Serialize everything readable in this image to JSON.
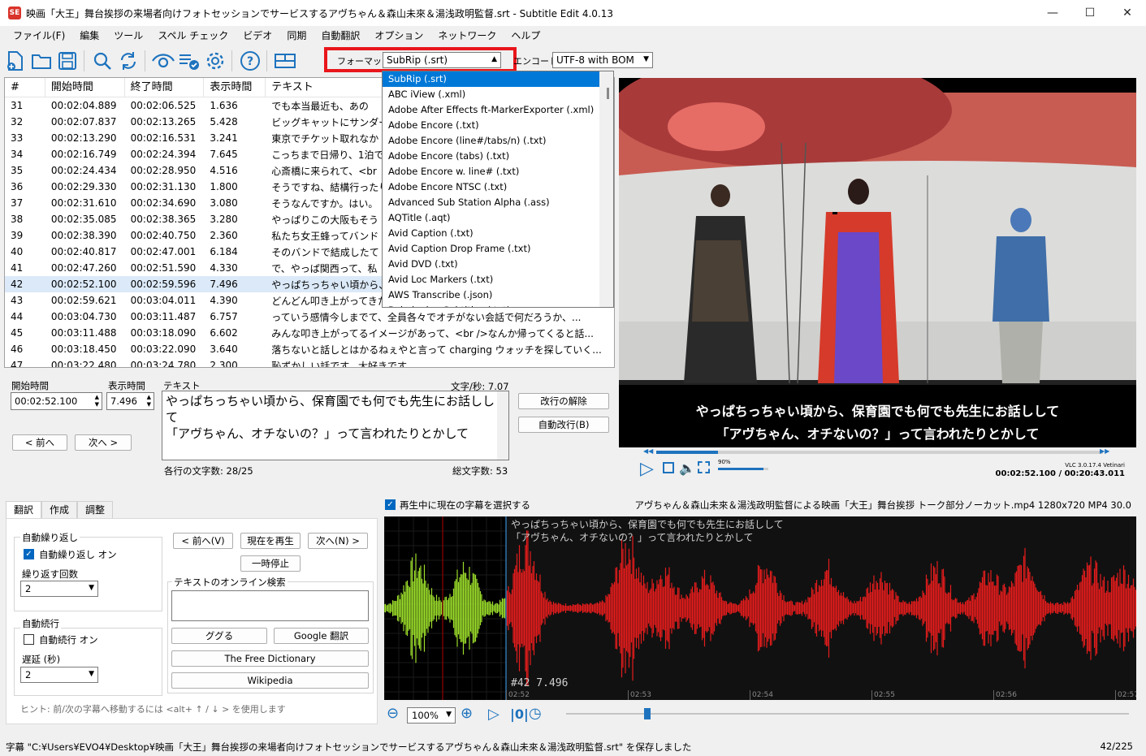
{
  "window": {
    "title": "映画「大王」舞台挨拶の来場者向けフォトセッションでサービスするアヴちゃん＆森山未來＆湯浅政明監督.srt - Subtitle Edit 4.0.13",
    "app_icon_text": "SE"
  },
  "menu": [
    "ファイル(F)",
    "編集",
    "ツール",
    "スペル チェック",
    "ビデオ",
    "同期",
    "自動翻訳",
    "オプション",
    "ネットワーク",
    "ヘルプ"
  ],
  "toolbar": {
    "format_label": "フォーマット",
    "format_value": "SubRip (.srt)",
    "encoding_label": "エンコード",
    "encoding_value": "UTF-8 with BOM"
  },
  "table": {
    "headers": [
      "#",
      "開始時間",
      "終了時間",
      "表示時間",
      "テキスト"
    ],
    "rows": [
      [
        "31",
        "00:02:04.889",
        "00:02:06.525",
        "1.636",
        "でも本当最近も、あの"
      ],
      [
        "32",
        "00:02:07.837",
        "00:02:13.265",
        "5.428",
        "ビッグキャットにサンダー"
      ],
      [
        "33",
        "00:02:13.290",
        "00:02:16.531",
        "3.241",
        "東京でチケット取れなか"
      ],
      [
        "34",
        "00:02:16.749",
        "00:02:24.394",
        "7.645",
        "こっちまで日帰り、1泊で"
      ],
      [
        "35",
        "00:02:24.434",
        "00:02:28.950",
        "4.516",
        "心斎橋に来られて、<br"
      ],
      [
        "36",
        "00:02:29.330",
        "00:02:31.130",
        "1.800",
        "そうですね、結構行ったり"
      ],
      [
        "37",
        "00:02:31.610",
        "00:02:34.690",
        "3.080",
        "そうなんですか。はい。"
      ],
      [
        "38",
        "00:02:35.085",
        "00:02:38.365",
        "3.280",
        "やっぱりこの大阪もそう"
      ],
      [
        "39",
        "00:02:38.390",
        "00:02:40.750",
        "2.360",
        "私たち女王蜂ってバンド"
      ],
      [
        "40",
        "00:02:40.817",
        "00:02:47.001",
        "6.184",
        "そのバンドで結成したて"
      ],
      [
        "41",
        "00:02:47.260",
        "00:02:51.590",
        "4.330",
        "で、やっぱ関西って、私"
      ],
      [
        "42",
        "00:02:52.100",
        "00:02:59.596",
        "7.496",
        "やっぱちっちゃい頃から、"
      ],
      [
        "43",
        "00:02:59.621",
        "00:03:04.011",
        "4.390",
        "どんどん叩き上がってきた"
      ],
      [
        "44",
        "00:03:04.730",
        "00:03:11.487",
        "6.757",
        "っていう感情今しまでて、全員各々でオチがない会話で何だろうか、..."
      ],
      [
        "45",
        "00:03:11.488",
        "00:03:18.090",
        "6.602",
        "みんな叩き上がってるイメージがあって、<br />なんか帰ってくると話..."
      ],
      [
        "46",
        "00:03:18.450",
        "00:03:22.090",
        "3.640",
        "落ちないと話しとはかるねぇやと言って charging ウォッチを探していく..."
      ],
      [
        "47",
        "00:03:22.480",
        "00:03:24.780",
        "2.300",
        "恥ずかしい話です。大好きです"
      ]
    ]
  },
  "format_dropdown": [
    "SubRip (.srt)",
    "ABC iView (.xml)",
    "Adobe After Effects ft-MarkerExporter (.xml)",
    "Adobe Encore (.txt)",
    "Adobe Encore (line#/tabs/n) (.txt)",
    "Adobe Encore (tabs) (.txt)",
    "Adobe Encore w. line# (.txt)",
    "Adobe Encore NTSC (.txt)",
    "Advanced Sub Station Alpha (.ass)",
    "AQTitle (.aqt)",
    "Avid Caption (.txt)",
    "Avid Caption Drop Frame (.txt)",
    "Avid DVD (.txt)",
    "Avid Loc Markers (.txt)",
    "AWS Transcribe (.json)",
    "Babylonian Subtitles (.txt)"
  ],
  "edit": {
    "start_label": "開始時間",
    "start_value": "00:02:52.100",
    "duration_label": "表示時間",
    "duration_value": "7.496",
    "text_label": "テキスト",
    "cps_label": "文字/秒: 7.07",
    "text_line1": "やっぱちっちゃい頃から、保育園でも何でも先生にお話しして",
    "text_line2": "「アヴちゃん、オチないの？」って言われたりとかして",
    "prev_button": "< 前へ",
    "next_button": "次へ >",
    "unbreak_button": "改行の解除",
    "autobreak_button": "自動改行(B)",
    "line_length": "各行の文字数: 28/25",
    "total_length": "総文字数: 53"
  },
  "video": {
    "subtitle_line1": "やっぱちっちゃい頃から、保育園でも何でも先生にお話しして",
    "subtitle_line2": "「アヴちゃん、オチないの？」って言われたりとかして",
    "volume": "90%",
    "vlc_version": "VLC 3.0.17.4 Vetinari",
    "time": "00:02:52.100 / 00:20:43.011",
    "progress": 0.138,
    "volume_level": 0.9
  },
  "tabs": [
    "翻訳",
    "作成",
    "調整"
  ],
  "translate": {
    "auto_repeat_group": "自動繰り返し",
    "auto_repeat_on": "自動繰り返し オン",
    "repeat_count_label": "繰り返す回数",
    "repeat_count_value": "2",
    "auto_continue_group": "自動続行",
    "auto_continue_on": "自動続行 オン",
    "delay_label": "遅延 (秒)",
    "delay_value": "2",
    "prev_button": "< 前へ(V)",
    "play_current_button": "現在を再生",
    "next_button": "次へ(N) >",
    "pause_button": "一時停止",
    "online_search_label": "テキストのオンライン検索",
    "google_button": "ググる",
    "google_translate_button": "Google 翻訳",
    "free_dictionary_button": "The Free Dictionary",
    "wikipedia_button": "Wikipedia",
    "hint": "ヒント: 前/次の字幕へ移動するには <alt+ ↑ / ↓ > を使用します"
  },
  "waveform": {
    "select_current_label": "再生中に現在の字幕を選択する",
    "video_info": "アヴちゃん＆森山未來＆湯浅政明監督による映画「大王」舞台挨拶 トーク部分ノーカット.mp4 1280x720 MP4 30.0",
    "subtitle_line1": "やっぱちっちゃい頃から、保育園でも何でも先生にお話しして",
    "subtitle_line2": "「アヴちゃん、オチないの？」って言われたりとかして",
    "marker": "#42  7.496",
    "ticks": [
      "02:52",
      "02:53",
      "02:54",
      "02:55",
      "02:56",
      "02:57"
    ],
    "zoom_value": "100%",
    "colors": {
      "selected": "#9bdc2a",
      "other": "#e51c1c",
      "background": "#000000"
    }
  },
  "status": {
    "message": "字幕 \"C:¥Users¥EVO4¥Desktop¥映画「大王」舞台挨拶の来場者向けフォトセッションでサービスするアヴちゃん＆森山未來＆湯浅政明監督.srt\" を保存しました",
    "position": "42/225"
  }
}
